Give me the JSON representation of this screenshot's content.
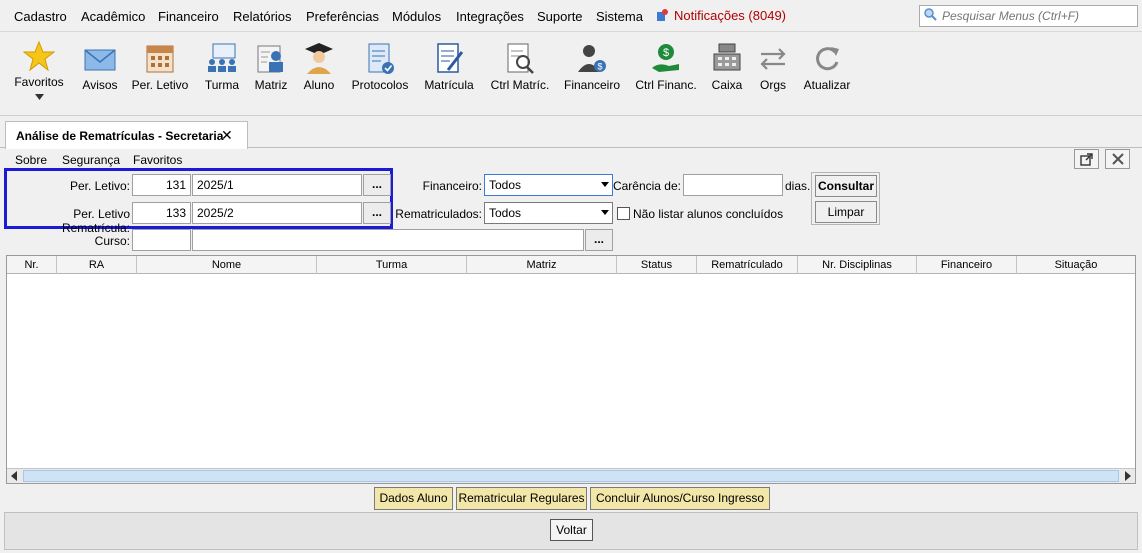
{
  "menu": {
    "items": [
      "Cadastro",
      "Acadêmico",
      "Financeiro",
      "Relatórios",
      "Preferências",
      "Módulos",
      "Integrações",
      "Suporte",
      "Sistema"
    ],
    "notifications": "Notificações (8049)",
    "search_placeholder": "Pesquisar Menus (Ctrl+F)"
  },
  "toolbar": {
    "favorites": "Favoritos",
    "buttons": [
      "Avisos",
      "Per. Letivo",
      "Turma",
      "Matriz",
      "Aluno",
      "Protocolos",
      "Matrícula",
      "Ctrl Matríc.",
      "Financeiro",
      "Ctrl Financ.",
      "Caixa",
      "Orgs",
      "Atualizar"
    ]
  },
  "tab": {
    "title": "Análise de Rematrículas - Secretaria",
    "close": "✕"
  },
  "submenu": [
    "Sobre",
    "Segurança",
    "Favoritos"
  ],
  "form": {
    "per_letivo_label": "Per. Letivo:",
    "per_letivo_code": "131",
    "per_letivo_value": "2025/1",
    "per_letivo_remat_label": "Per. Letivo Rematrícula:",
    "per_letivo_remat_code": "133",
    "per_letivo_remat_value": "2025/2",
    "curso_label": "Curso:",
    "curso_code": "",
    "curso_value": "",
    "lookup_button": "...",
    "financeiro_label": "Financeiro:",
    "financeiro_value": "Todos",
    "rematriculados_label": "Rematriculados:",
    "rematriculados_value": "Todos",
    "carencia_label": "Carência de:",
    "carencia_value": "",
    "dias_label": "dias.",
    "nao_listar_label": "Não listar alunos concluídos",
    "nao_listar_checked": false,
    "consultar_button": "Consultar",
    "limpar_button": "Limpar"
  },
  "grid": {
    "columns": [
      "Nr.",
      "RA",
      "Nome",
      "Turma",
      "Matriz",
      "Status",
      "Rematrículado",
      "Nr. Disciplinas",
      "Financeiro",
      "Situação"
    ],
    "rows": []
  },
  "actions": {
    "dados_aluno": "Dados Aluno",
    "rematricular_regulares": "Rematricular Regulares",
    "concluir": "Concluir Alunos/Curso Ingresso",
    "voltar": "Voltar"
  },
  "colors": {
    "highlight_border": "#1a1ad8",
    "action_button": "#f2e6a8",
    "notification": "#b00000"
  }
}
